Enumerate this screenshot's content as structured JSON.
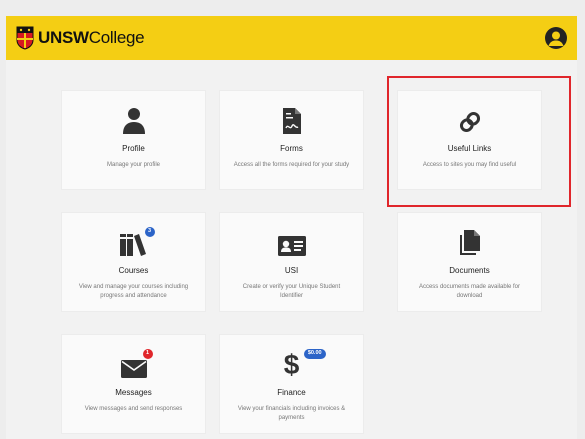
{
  "header": {
    "logo_text_bold": "UNSW",
    "logo_text": "College",
    "user_icon": "user-circle-icon"
  },
  "tiles": [
    {
      "title": "Profile",
      "desc": "Manage your profile",
      "icon": "person-icon"
    },
    {
      "title": "Forms",
      "desc": "Access all the forms required for your study",
      "icon": "form-document-icon"
    },
    {
      "title": "Useful Links",
      "desc": "Access to sites you may find useful",
      "icon": "link-icon"
    },
    {
      "title": "Courses",
      "desc": "View and manage your courses including progress and attendance",
      "icon": "books-icon",
      "badge": "3"
    },
    {
      "title": "USI",
      "desc": "Create or verify your Unique Student Identifier",
      "icon": "id-card-icon"
    },
    {
      "title": "Documents",
      "desc": "Access documents made available for download",
      "icon": "documents-icon"
    },
    {
      "title": "Messages",
      "desc": "View messages and send responses",
      "icon": "envelope-icon",
      "badge": "1"
    },
    {
      "title": "Finance",
      "desc": "View your financials including invoices & payments",
      "icon": "dollar-icon",
      "badge": "$0.00"
    }
  ],
  "colors": {
    "header_bg": "#f4ce14",
    "highlight": "#e0262b",
    "badge_blue": "#2c64c8",
    "badge_red": "#e0262b"
  }
}
